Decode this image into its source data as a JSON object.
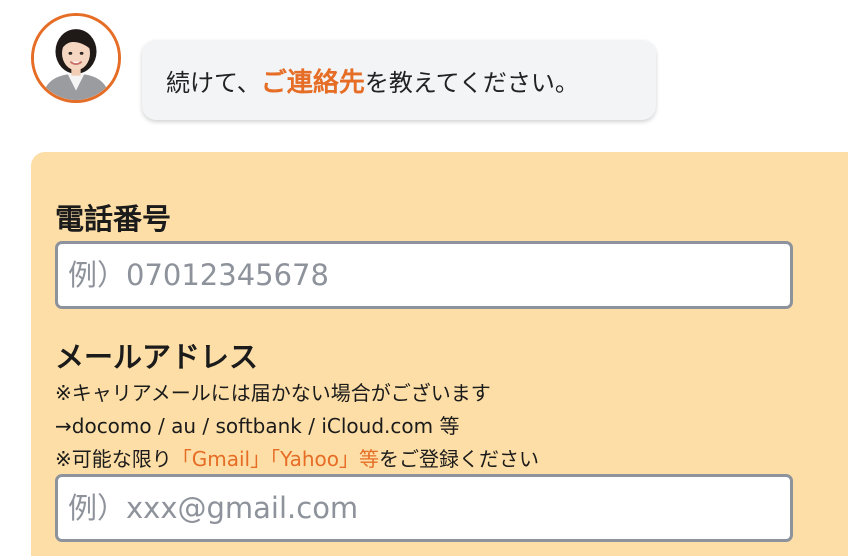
{
  "chat": {
    "message_before": "続けて、",
    "message_highlight": "ご連絡先",
    "message_after": "を教えてください。"
  },
  "form": {
    "phone": {
      "label": "電話番号",
      "placeholder": "例）07012345678"
    },
    "email": {
      "label": "メールアドレス",
      "note_line1": "※キャリアメールには届かない場合がございます",
      "note_line2": "→docomo / au / softbank / iCloud.com 等",
      "note_line3_prefix": "※可能な限り",
      "note_line3_highlight": "「Gmail」「Yahoo」等",
      "note_line3_suffix": "をご登録ください",
      "placeholder": "例）xxx@gmail.com"
    }
  },
  "colors": {
    "accent": "#e56d25",
    "card_background": "#fddea6",
    "bubble_background": "#f3f4f6"
  }
}
